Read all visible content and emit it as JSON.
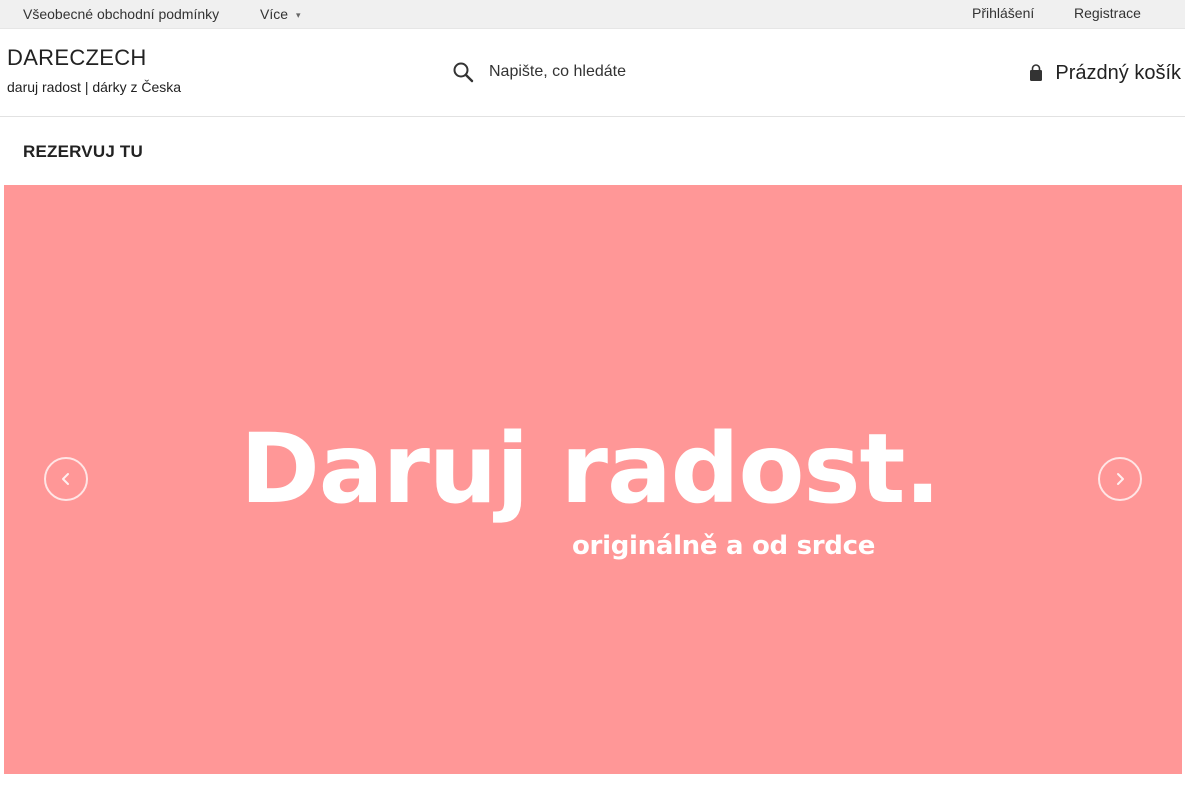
{
  "topbar": {
    "terms_link": "Všeobecné obchodní podmínky",
    "more_link": "Více",
    "more_icon": "chevron-down-icon",
    "login_link": "Přihlášení",
    "register_link": "Registrace"
  },
  "header": {
    "logo_title": "DARECZECH",
    "logo_subtitle": "daruj radost | dárky z Česka",
    "search": {
      "icon": "search-icon",
      "placeholder": "Napište, co hledáte"
    },
    "cart": {
      "icon": "cart-icon",
      "label": "Prázdný košík"
    }
  },
  "nav": {
    "items": [
      {
        "label": "REZERVUJ TU"
      }
    ]
  },
  "hero": {
    "background_color": "#ff9797",
    "headline": "Daruj radost.",
    "subline": "originálně a od srdce",
    "prev_icon": "arrow-left-icon",
    "next_icon": "arrow-right-icon"
  }
}
